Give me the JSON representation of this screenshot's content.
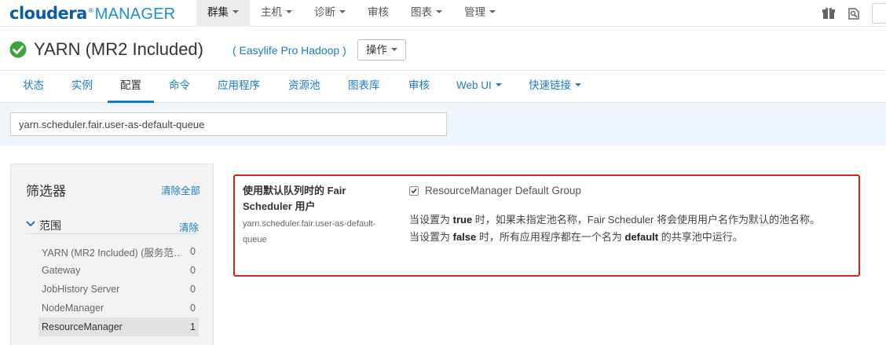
{
  "logo": {
    "brand": "cloudera",
    "reg": "®",
    "product": "MANAGER"
  },
  "topnav": [
    {
      "label": "群集",
      "active": true
    },
    {
      "label": "主机",
      "active": false
    },
    {
      "label": "诊断",
      "active": false
    },
    {
      "label": "审核",
      "active": false
    },
    {
      "label": "图表",
      "active": false
    },
    {
      "label": "管理",
      "active": false
    }
  ],
  "service": {
    "status": "good",
    "title": "YARN (MR2 Included)",
    "cluster_link": "( Easylife Pro Hadoop )",
    "action_button": "操作"
  },
  "tabs": [
    {
      "label": "状态"
    },
    {
      "label": "实例"
    },
    {
      "label": "配置",
      "active": true
    },
    {
      "label": "命令"
    },
    {
      "label": "应用程序"
    },
    {
      "label": "资源池"
    },
    {
      "label": "图表库"
    },
    {
      "label": "审核"
    },
    {
      "label": "Web UI"
    },
    {
      "label": "快速链接"
    }
  ],
  "search": {
    "value": "yarn.scheduler.fair.user-as-default-queue"
  },
  "filters": {
    "title": "筛选器",
    "clear_all": "清除全部",
    "scope": {
      "label": "范围",
      "clear": "清除"
    },
    "items": [
      {
        "name": "YARN (MR2 Included) (服务范…",
        "count": "0"
      },
      {
        "name": "Gateway",
        "count": "0"
      },
      {
        "name": "JobHistory Server",
        "count": "0"
      },
      {
        "name": "NodeManager",
        "count": "0"
      },
      {
        "name": "ResourceManager",
        "count": "1",
        "selected": true
      }
    ]
  },
  "config": {
    "display_name_line1": "使用默认队列时的 Fair",
    "display_name_line2": "Scheduler 用户",
    "key_line1": "yarn.scheduler.fair.user-as-default-",
    "key_line2": "queue",
    "checked": true,
    "group": "ResourceManager Default Group",
    "desc1_pre": "当设置为 ",
    "desc1_bold": "true",
    "desc1_post": " 时，如果未指定池名称，Fair Scheduler 将会使用用户名作为默认的池名称。",
    "desc2_pre": "当设置为 ",
    "desc2_bold": "false",
    "desc2_mid": " 时，所有应用程序都在一个名为 ",
    "desc2_bold2": "default",
    "desc2_post": " 的共享池中运行。"
  },
  "colors": {
    "accent": "#1a7bc1",
    "ok": "#3aa33a",
    "highlight": "#e02020"
  }
}
